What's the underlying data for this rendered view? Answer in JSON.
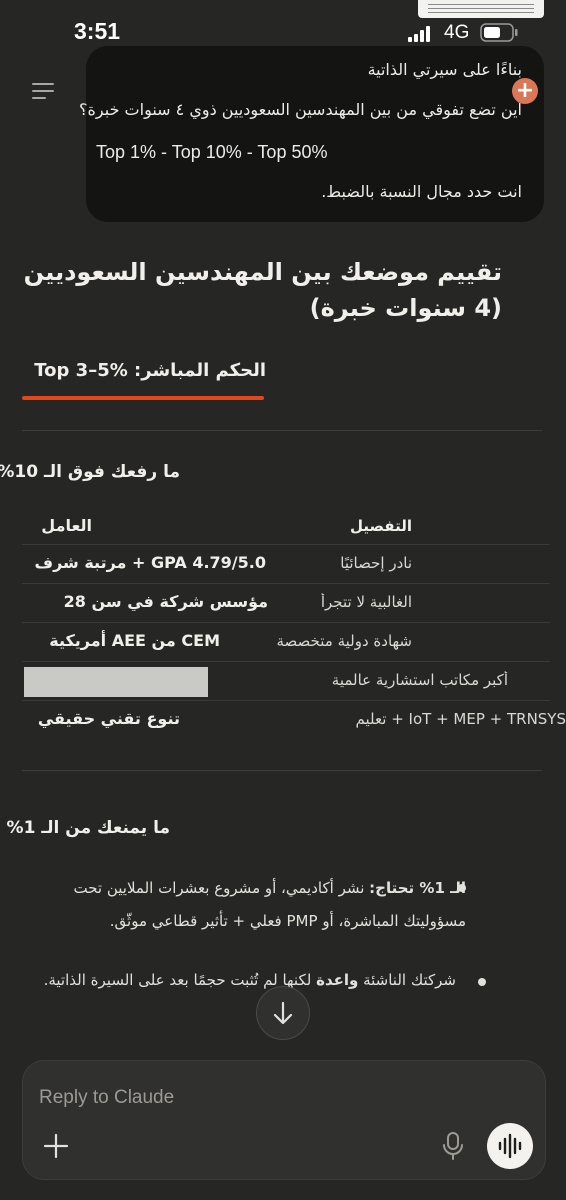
{
  "status_bar": {
    "time": "3:51",
    "network": "4G"
  },
  "user_message": {
    "lines": [
      "بناءًا على سيرتي الذاتية",
      "أين تضع تفوقي من بين المهندسين السعوديين ذوي ٤ سنوات خبرة؟",
      "Top 1% - Top 10% - Top 50%",
      "انت حدد مجال النسبة بالضبط."
    ]
  },
  "response": {
    "title": "تقييم موضعك بين المهندسين السعوديين (4 سنوات خبرة)",
    "verdict": "الحكم المباشر: Top 3–5%",
    "section1_heading": "ما رفعك فوق الـ 10%",
    "table": {
      "headers": {
        "factor": "العامل",
        "detail": "التفصيل"
      },
      "rows": [
        {
          "factor": "GPA 4.79/5.0 + مرتبة شرف",
          "detail": "نادر إحصائيًا"
        },
        {
          "factor": "مؤسس شركة في سن 28",
          "detail": "الغالبية لا تتجرأ"
        },
        {
          "factor": "CEM من AEE أمريكية",
          "detail": "شهادة دولية متخصصة"
        },
        {
          "factor": "",
          "detail": "أكبر مكاتب استشارية عالمية"
        },
        {
          "factor": "تنوع تقني حقيقي",
          "detail": "IoT + MEP + TRNSYS + تعليم"
        }
      ]
    },
    "section2_heading": "ما يمنعك من الـ 1%",
    "bullets": [
      {
        "bold": "الـ 1% تحتاج:",
        "text": " نشر أكاديمي، أو مشروع بعشرات الملايين تحت مسؤوليتك المباشرة، أو PMP فعلي + تأثير قطاعي موثّق."
      },
      {
        "pre": "شركتك الناشئة ",
        "bold": "واعدة",
        "text": " لكنها لم تُثبت حجمًا بعد على السيرة الذاتية."
      }
    ]
  },
  "composer": {
    "placeholder": "Reply to Claude"
  },
  "colors": {
    "background": "#262624",
    "bubble": "#141413",
    "accent": "#D97757",
    "underline": "#E4471C"
  }
}
